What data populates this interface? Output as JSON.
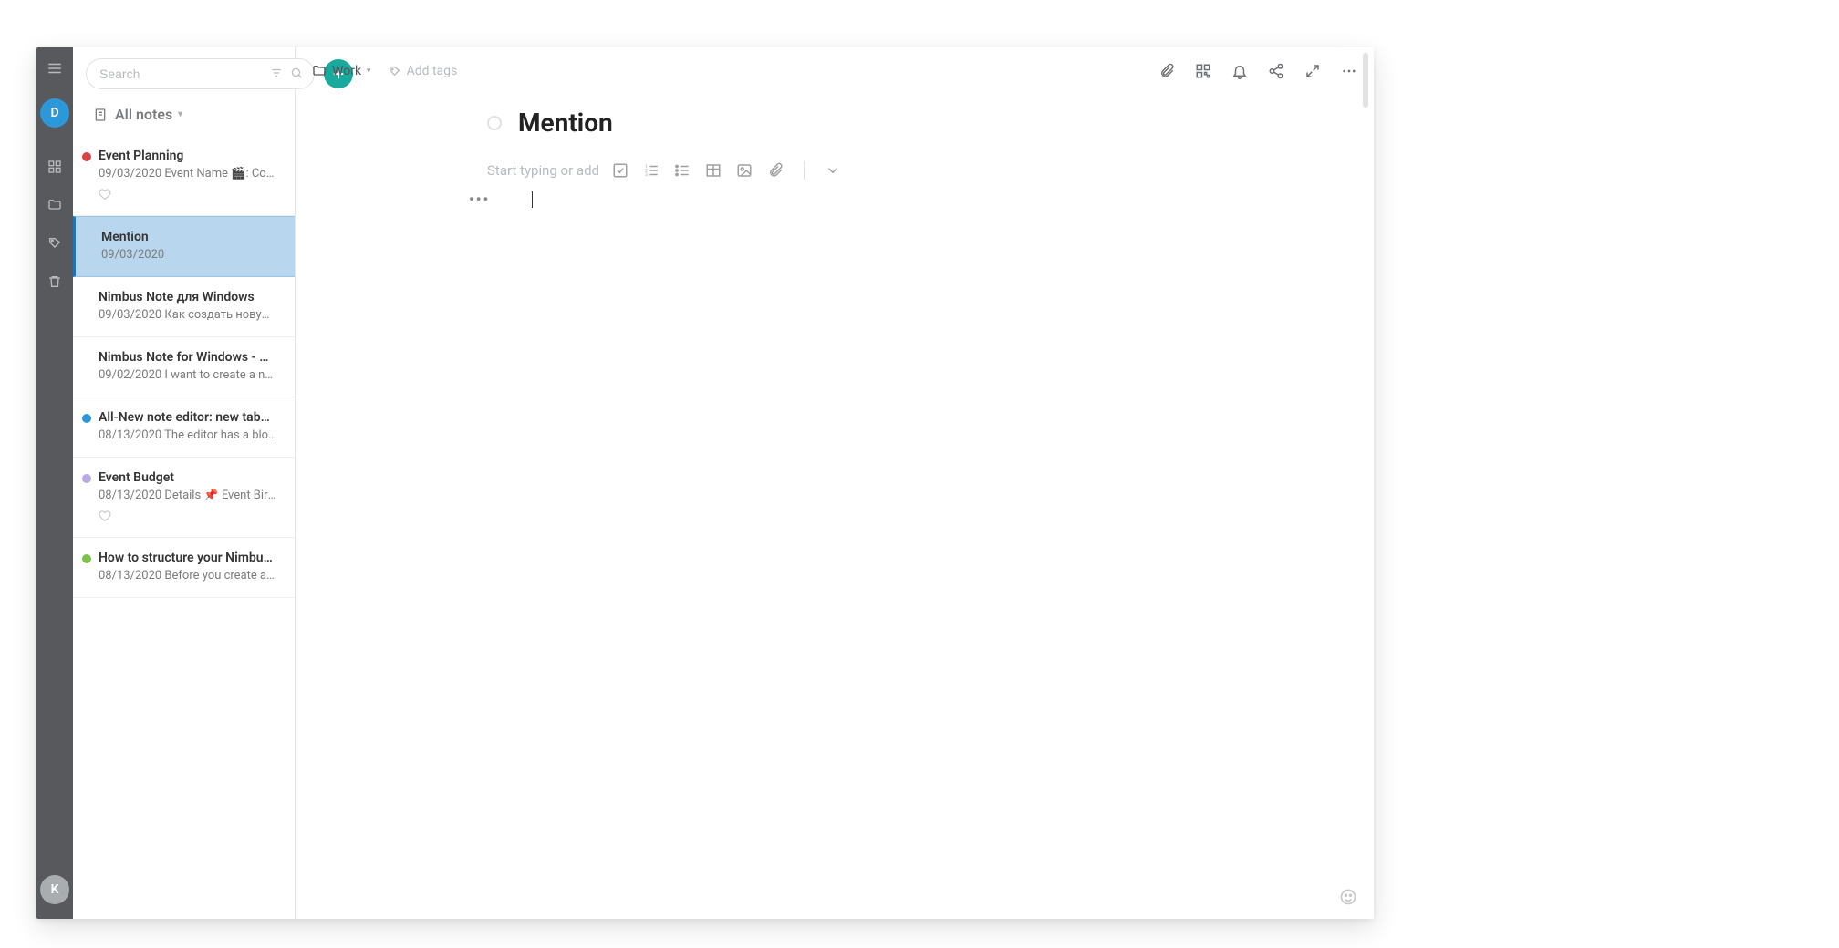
{
  "search": {
    "placeholder": "Search"
  },
  "panel_title": "All notes",
  "avatars": {
    "top": "D",
    "bottom": "K"
  },
  "breadcrumb": {
    "label": "Work"
  },
  "tags_placeholder": "Add tags",
  "editor": {
    "title": "Mention",
    "placeholder": "Start typing or add"
  },
  "notes": [
    {
      "title": "Event Planning",
      "date": "09/03/2020",
      "snippet": "Event Name 🎬: Com…",
      "dot": "#d64542",
      "fav": true
    },
    {
      "title": "Mention",
      "date": "09/03/2020",
      "snippet": "",
      "dot": null,
      "active": true
    },
    {
      "title": "Nimbus Note для Windows",
      "date": "09/03/2020",
      "snippet": "Как создать новую з…",
      "dot": null
    },
    {
      "title": "Nimbus Note for Windows - …",
      "date": "09/02/2020",
      "snippet": "I want to create a not…",
      "dot": null
    },
    {
      "title": "All-New note editor: new tab…",
      "date": "08/13/2020",
      "snippet": "The editor has a bloc…",
      "dot": "#2c98d9"
    },
    {
      "title": "Event Budget",
      "date": "08/13/2020",
      "snippet": "Details 📌 Event Birt…",
      "dot": "#b6a9e6",
      "fav": true
    },
    {
      "title": "How to structure your Nimbu…",
      "date": "08/13/2020",
      "snippet": "Before you create an…",
      "dot": "#7cc24a"
    }
  ]
}
